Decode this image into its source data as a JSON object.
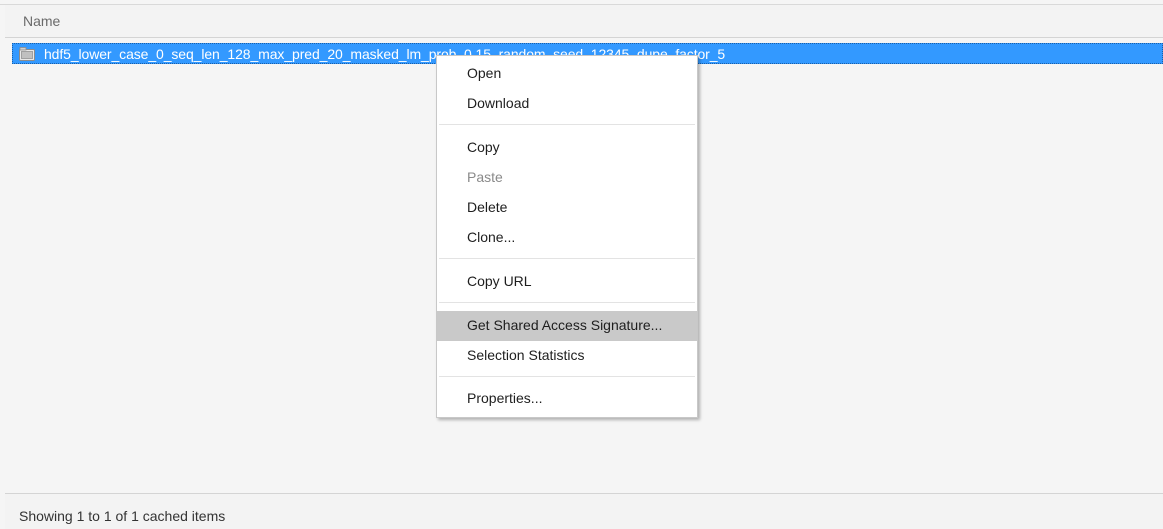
{
  "header": {
    "name_label": "Name"
  },
  "file": {
    "name": "hdf5_lower_case_0_seq_len_128_max_pred_20_masked_lm_prob_0.15_random_seed_12345_dupe_factor_5",
    "icon": "folder-icon"
  },
  "context_menu": {
    "open": "Open",
    "download": "Download",
    "copy": "Copy",
    "paste": "Paste",
    "delete": "Delete",
    "clone": "Clone...",
    "copy_url": "Copy URL",
    "get_sas": "Get Shared Access Signature...",
    "selection_statistics": "Selection Statistics",
    "properties": "Properties..."
  },
  "footer": {
    "status": "Showing 1 to 1 of 1 cached items"
  },
  "colors": {
    "selection": "#3399ff",
    "menu_hover": "#c9c9c9",
    "background": "#f5f5f5"
  }
}
